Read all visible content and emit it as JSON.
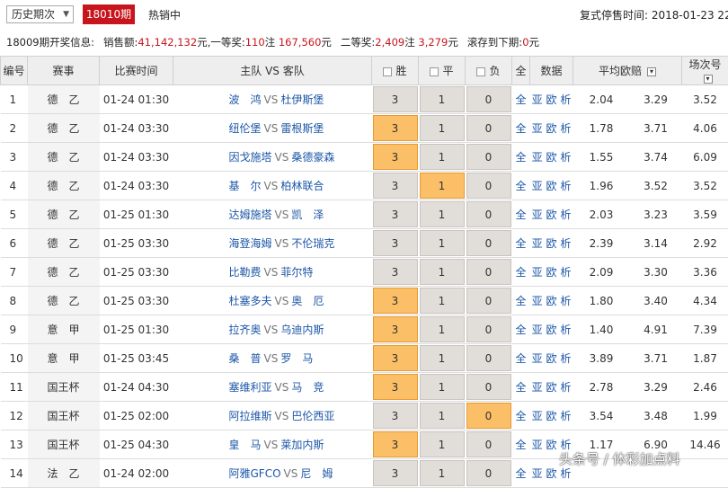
{
  "header": {
    "history_select": "历史期次",
    "current_period": "18010期",
    "hot_label": "热销中",
    "stop_time_label": "复式停售时间:",
    "stop_time_value": "2018-01-23 22"
  },
  "info": {
    "prefix": "18009期开奖信息:",
    "sales_label": "销售额:",
    "sales_value": "41,142,132",
    "yuan1": "元,",
    "first_label": "一等奖:",
    "first_count": "110",
    "first_unit": "注",
    "first_amount": "167,560",
    "yuan2": "元",
    "second_label": "二等奖:",
    "second_count": "2,409",
    "second_unit": "注",
    "second_amount": "3,279",
    "yuan3": "元",
    "roll_label": "滚存到下期:",
    "roll_value": "0",
    "yuan4": "元"
  },
  "columns": {
    "no": "编号",
    "league": "赛事",
    "time": "比赛时间",
    "teams": "主队 VS 客队",
    "win": "胜",
    "draw": "平",
    "lose": "负",
    "all": "全",
    "data": "数据",
    "avg_odds": "平均欧赔",
    "match_no": "场次号"
  },
  "vs_text": "VS",
  "all_link": "全",
  "data_link_a": "亚",
  "data_link_b": "欧",
  "data_link_c": "析",
  "bet_win": "3",
  "bet_draw": "1",
  "bet_lose": "0",
  "colors": {
    "period_bg": "#c8141c",
    "selected_bet": "#fbbf67",
    "bet_default": "#e1ddd9",
    "link": "#1c57a8"
  },
  "matches": [
    {
      "no": "1",
      "league": "德　乙",
      "time": "01-24 01:30",
      "home": "波　鸿",
      "away": "杜伊斯堡",
      "sel": "",
      "o1": "2.04",
      "o2": "3.29",
      "o3": "3.52"
    },
    {
      "no": "2",
      "league": "德　乙",
      "time": "01-24 03:30",
      "home": "纽伦堡",
      "away": "雷根斯堡",
      "sel": "win",
      "o1": "1.78",
      "o2": "3.71",
      "o3": "4.06"
    },
    {
      "no": "3",
      "league": "德　乙",
      "time": "01-24 03:30",
      "home": "因戈施塔",
      "away": "桑德豪森",
      "sel": "win",
      "o1": "1.55",
      "o2": "3.74",
      "o3": "6.09"
    },
    {
      "no": "4",
      "league": "德　乙",
      "time": "01-24 03:30",
      "home": "基　尔",
      "away": "柏林联合",
      "sel": "draw",
      "o1": "1.96",
      "o2": "3.52",
      "o3": "3.52"
    },
    {
      "no": "5",
      "league": "德　乙",
      "time": "01-25 01:30",
      "home": "达姆施塔",
      "away": "凯　泽",
      "sel": "",
      "o1": "2.03",
      "o2": "3.23",
      "o3": "3.59"
    },
    {
      "no": "6",
      "league": "德　乙",
      "time": "01-25 03:30",
      "home": "海登海姆",
      "away": "不伦瑞克",
      "sel": "",
      "o1": "2.39",
      "o2": "3.14",
      "o3": "2.92"
    },
    {
      "no": "7",
      "league": "德　乙",
      "time": "01-25 03:30",
      "home": "比勒费",
      "away": "菲尔特",
      "sel": "",
      "o1": "2.09",
      "o2": "3.30",
      "o3": "3.36"
    },
    {
      "no": "8",
      "league": "德　乙",
      "time": "01-25 03:30",
      "home": "杜塞多夫",
      "away": "奥　厄",
      "sel": "win",
      "o1": "1.80",
      "o2": "3.40",
      "o3": "4.34"
    },
    {
      "no": "9",
      "league": "意　甲",
      "time": "01-25 01:30",
      "home": "拉齐奥",
      "away": "乌迪内斯",
      "sel": "win",
      "o1": "1.40",
      "o2": "4.91",
      "o3": "7.39"
    },
    {
      "no": "10",
      "league": "意　甲",
      "time": "01-25 03:45",
      "home": "桑　普",
      "away": "罗　马",
      "sel": "win",
      "o1": "3.89",
      "o2": "3.71",
      "o3": "1.87"
    },
    {
      "no": "11",
      "league": "国王杯",
      "time": "01-24 04:30",
      "home": "塞维利亚",
      "away": "马　竞",
      "sel": "win",
      "o1": "2.78",
      "o2": "3.29",
      "o3": "2.46"
    },
    {
      "no": "12",
      "league": "国王杯",
      "time": "01-25 02:00",
      "home": "阿拉维斯",
      "away": "巴伦西亚",
      "sel": "lose",
      "o1": "3.54",
      "o2": "3.48",
      "o3": "1.99"
    },
    {
      "no": "13",
      "league": "国王杯",
      "time": "01-25 04:30",
      "home": "皇　马",
      "away": "莱加内斯",
      "sel": "win",
      "o1": "1.17",
      "o2": "6.90",
      "o3": "14.46"
    },
    {
      "no": "14",
      "league": "法　乙",
      "time": "01-24 02:00",
      "home": "阿雅GFCO",
      "away": "尼　姆",
      "sel": "",
      "o1": "",
      "o2": "",
      "o3": ""
    }
  ],
  "watermark": "头条号 / 体彩加点料"
}
